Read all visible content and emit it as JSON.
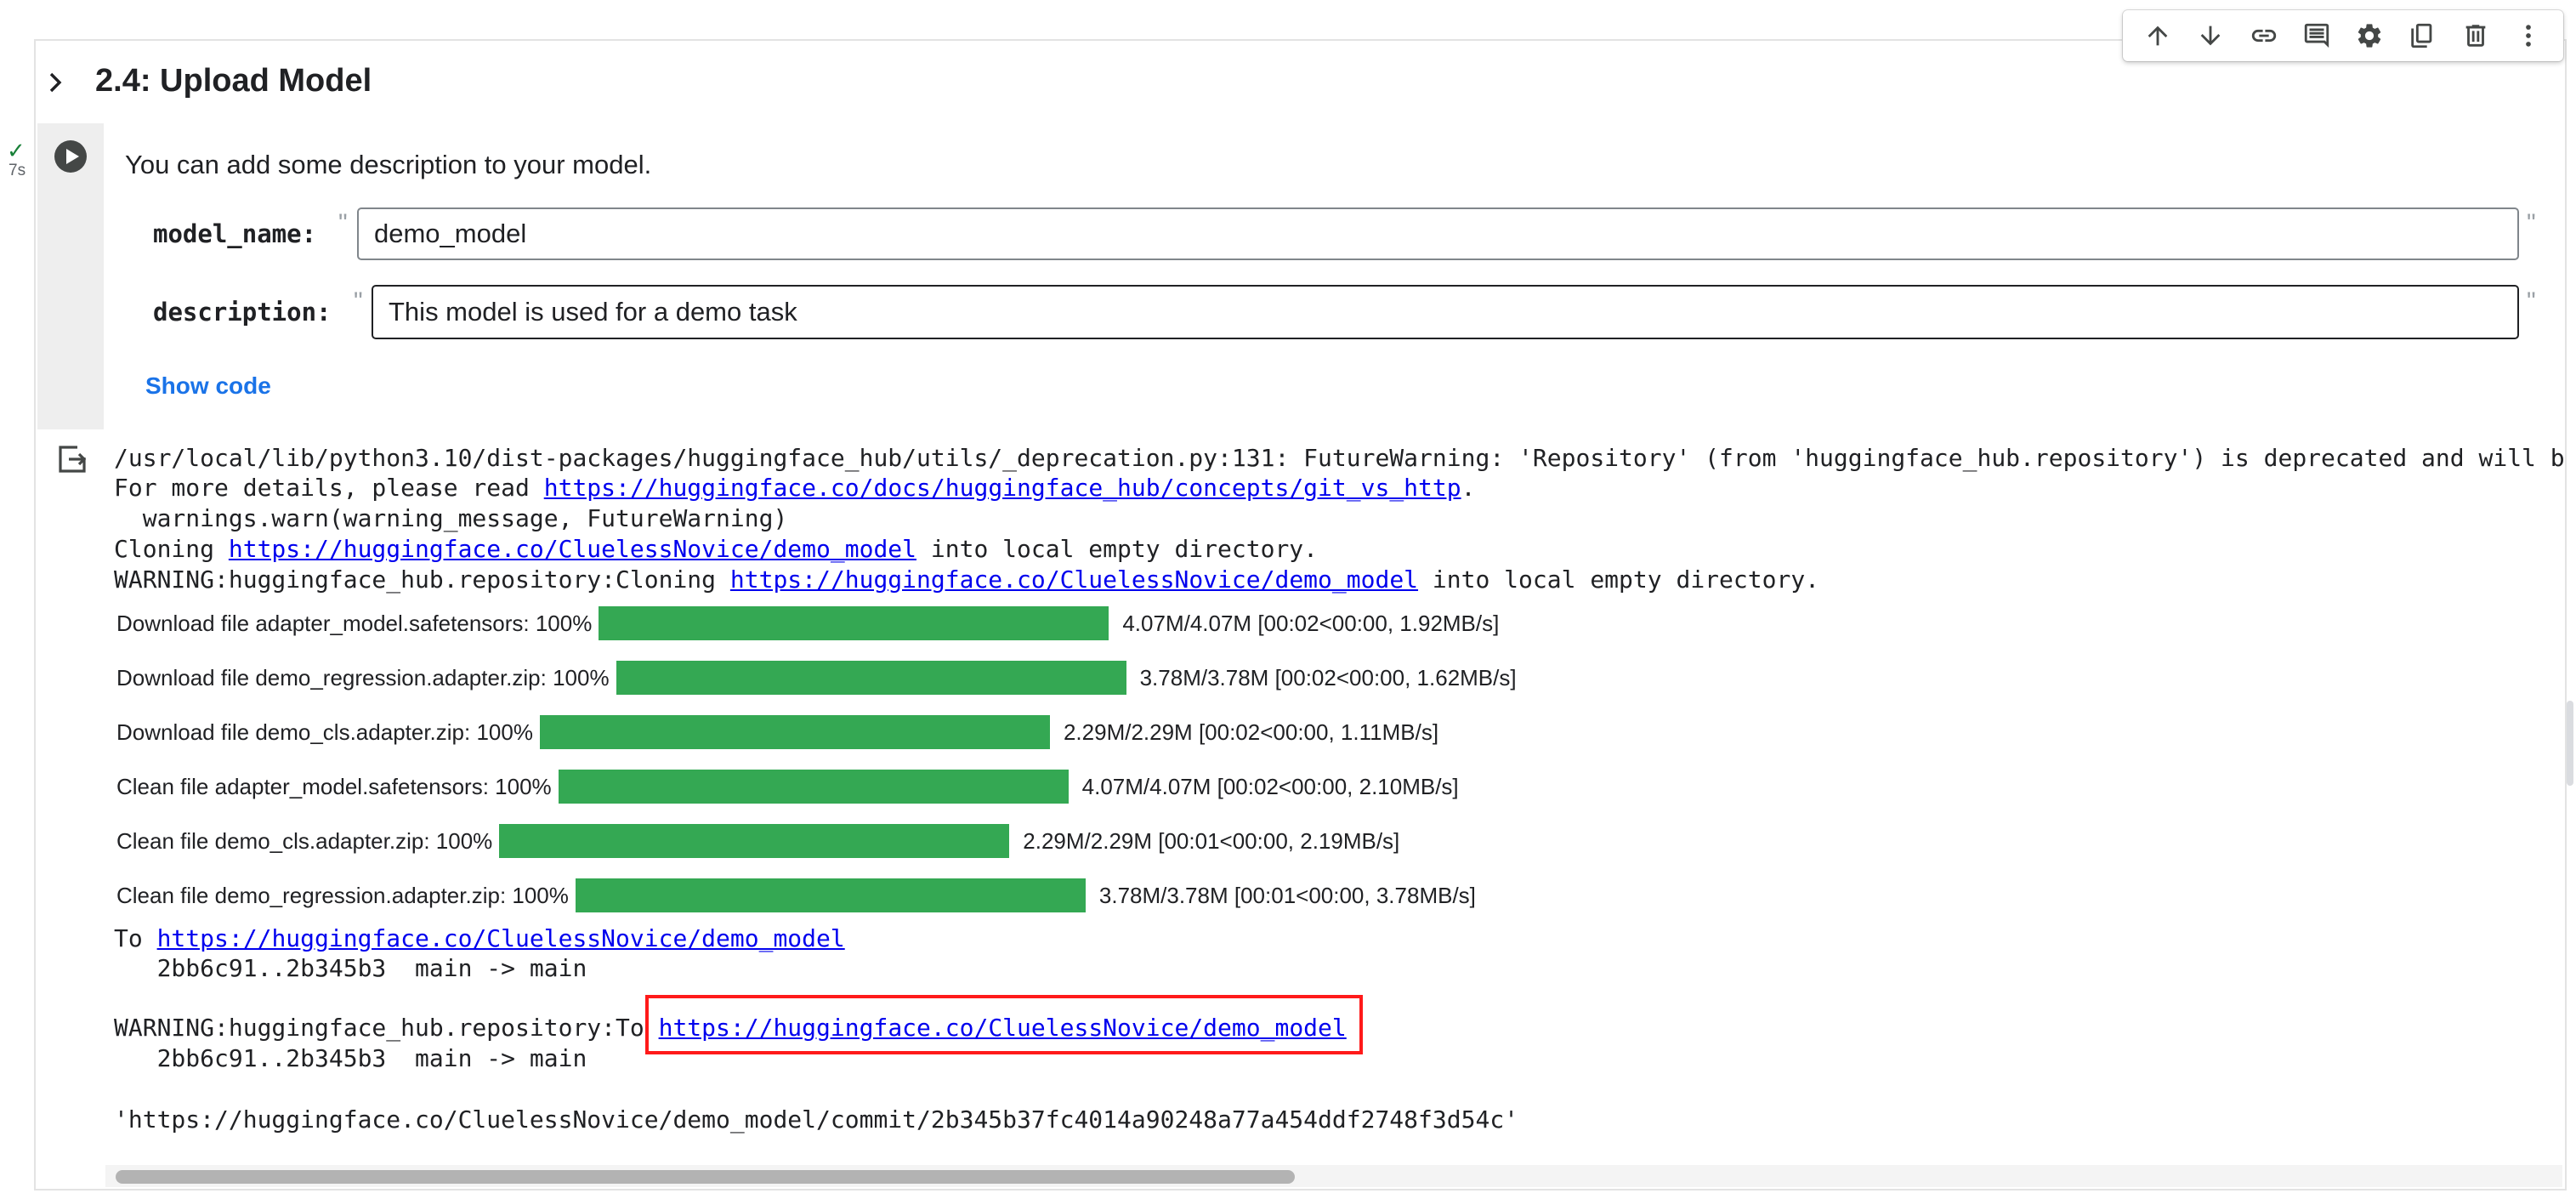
{
  "toolbar": {
    "buttons": [
      "arrow-up-icon",
      "arrow-down-icon",
      "link-icon",
      "comment-icon",
      "gear-icon",
      "mirror-cell-icon",
      "delete-icon",
      "more-vert-icon"
    ]
  },
  "section": {
    "title": "2.4: Upload Model"
  },
  "execution": {
    "status": "✓",
    "time": "7s"
  },
  "form": {
    "description_text": "You can add some description to your model.",
    "fields": [
      {
        "label": "model_name:",
        "value": "demo_model"
      },
      {
        "label": "description:",
        "value": "This model is used for a demo task"
      }
    ],
    "quote_mark": "\"",
    "show_code_label": "Show code"
  },
  "output": {
    "line1": "/usr/local/lib/python3.10/dist-packages/huggingface_hub/utils/_deprecation.py:131: FutureWarning: 'Repository' (from 'huggingface_hub.repository') is deprecated and will b",
    "line2_prefix": "For more details, please read ",
    "line2_link": "https://huggingface.co/docs/huggingface_hub/concepts/git_vs_http",
    "line2_suffix": ".",
    "line3": "  warnings.warn(warning_message, FutureWarning)",
    "line4_prefix": "Cloning ",
    "line4_link": "https://huggingface.co/CluelessNovice/demo_model",
    "line4_suffix": " into local empty directory.",
    "line5_prefix": "WARNING:huggingface_hub.repository:Cloning ",
    "line5_link": "https://huggingface.co/CluelessNovice/demo_model",
    "line5_suffix": " into local empty directory.",
    "progress": [
      {
        "label": "Download file adapter_model.safetensors: 100%",
        "fraction": 1.0,
        "stats": "4.07M/4.07M [00:02<00:00, 1.92MB/s]"
      },
      {
        "label": "Download file demo_regression.adapter.zip: 100%",
        "fraction": 1.0,
        "stats": "3.78M/3.78M [00:02<00:00, 1.62MB/s]"
      },
      {
        "label": "Download file demo_cls.adapter.zip: 100%",
        "fraction": 1.0,
        "stats": "2.29M/2.29M [00:02<00:00, 1.11MB/s]"
      },
      {
        "label": "Clean file adapter_model.safetensors: 100%",
        "fraction": 1.0,
        "stats": "4.07M/4.07M [00:02<00:00, 2.10MB/s]"
      },
      {
        "label": "Clean file demo_cls.adapter.zip: 100%",
        "fraction": 1.0,
        "stats": "2.29M/2.29M [00:01<00:00, 2.19MB/s]"
      },
      {
        "label": "Clean file demo_regression.adapter.zip: 100%",
        "fraction": 1.0,
        "stats": "3.78M/3.78M [00:01<00:00, 3.78MB/s]"
      }
    ],
    "to_prefix": "To ",
    "to_link": "https://huggingface.co/CluelessNovice/demo_model",
    "push_line": "   2bb6c91..2b345b3  main -> main",
    "warn_to_prefix": "WARNING:huggingface_hub.repository:To ",
    "warn_to_link": "https://huggingface.co/CluelessNovice/demo_model",
    "push_line2": "   2bb6c91..2b345b3  main -> main",
    "commit_url": "'https://huggingface.co/CluelessNovice/demo_model/commit/2b345b37fc4014a90248a77a454ddf2748f3d54c'"
  },
  "colors": {
    "progress_fill": "#34a853",
    "link": "#0000ee",
    "highlight": "#ff1a1a",
    "show_code": "#1a73e8"
  }
}
